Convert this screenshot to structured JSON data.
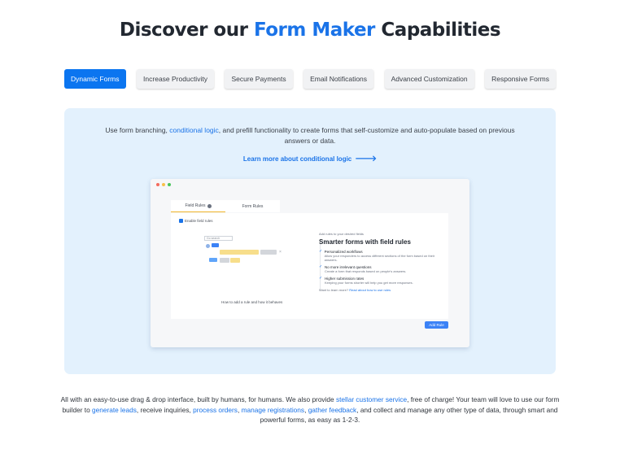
{
  "heading": {
    "prefix": "Discover our ",
    "accent": "Form Maker",
    "suffix": " Capabilities"
  },
  "tabs": [
    {
      "label": "Dynamic Forms",
      "active": true
    },
    {
      "label": "Increase Productivity",
      "active": false
    },
    {
      "label": "Secure Payments",
      "active": false
    },
    {
      "label": "Email Notifications",
      "active": false
    },
    {
      "label": "Advanced Customization",
      "active": false
    },
    {
      "label": "Responsive Forms",
      "active": false
    }
  ],
  "panel": {
    "intro_1": "Use form branching, ",
    "intro_link": "conditional logic",
    "intro_2": ", and prefill functionality to create forms that self-customize and auto-populate based on previous answers or data.",
    "learn_more": "Learn more about conditional logic",
    "learn_arrow": "🡒",
    "preview": {
      "tab_field_rules": "Field Rules",
      "tab_form_rules": "Form Rules",
      "checkbox_label": "Enable field rules",
      "search_placeholder": "Go search",
      "caption": "How to add a rule and how it behaves",
      "side_small": "Add rules to your desired fields",
      "side_title": "Smarter forms with field rules",
      "features": [
        {
          "title": "Personalized workflows",
          "desc": "Allow your responders to access different sections of the form based on their answers."
        },
        {
          "title": "No more irrelevant questions",
          "desc": "Create a form that responds based on people's answers."
        },
        {
          "title": "Higher submission rates",
          "desc": "Keeping your forms shorter will help you get more responses."
        }
      ],
      "want_text": "Want to learn more? ",
      "want_link": "Read about how to use rules",
      "add_rule": "Add Rule",
      "check_glyph": "✓",
      "remove_glyph": "×"
    }
  },
  "footer": {
    "p1": "All with an easy-to-use drag & drop interface, built by humans, for humans. We also provide ",
    "l1": "stellar customer service",
    "p2": ", free of charge! Your team will love to use our form builder to ",
    "l2": "generate leads",
    "p3": ", receive inquiries, ",
    "l3": "process orders",
    "p4": ", ",
    "l4": "manage registrations",
    "p5": ", ",
    "l5": "gather feedback",
    "p6": ", and collect and manage any other type of data, through smart and powerful forms, as easy as 1-2-3."
  },
  "colors": {
    "accent": "#1a73e8",
    "active_tab": "#0b75f0",
    "panel_bg": "#e3f1fd"
  },
  "icons": {
    "learn_more": "arrow-right-icon",
    "check": "check-icon",
    "info": "info-icon"
  }
}
